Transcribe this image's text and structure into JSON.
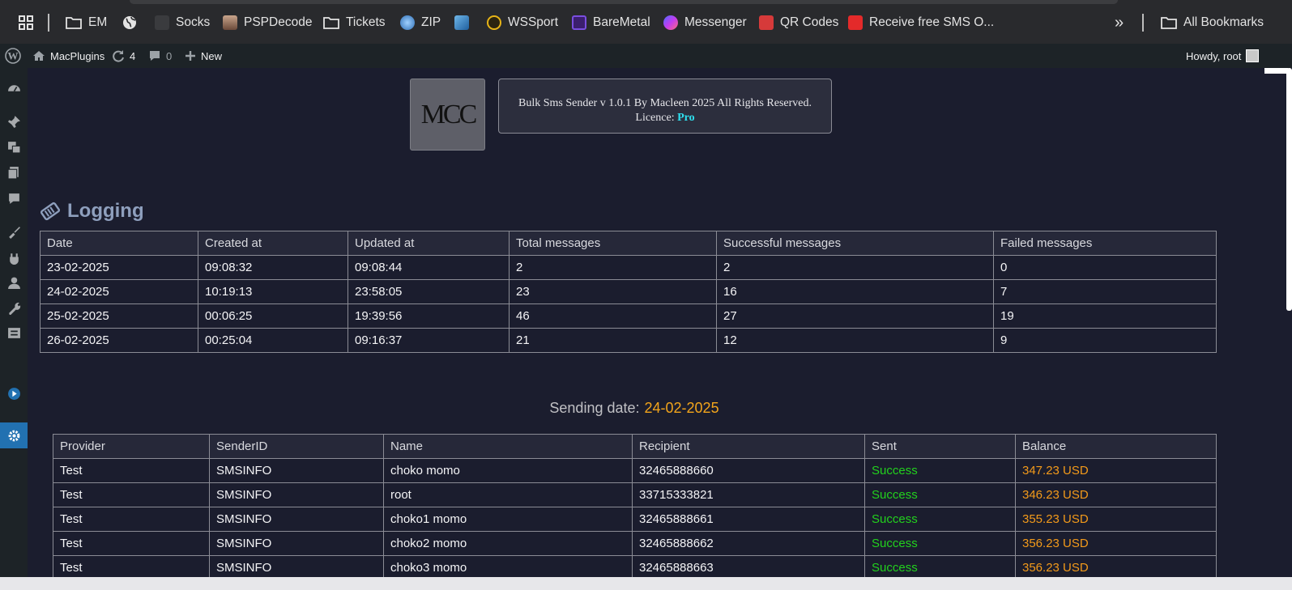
{
  "bookmarks": {
    "items": [
      {
        "label": "EM",
        "icon": "folder-icon"
      },
      {
        "label": "",
        "icon": "globe-icon"
      },
      {
        "label": "Socks",
        "icon": "socks-icon"
      },
      {
        "label": "PSPDecode",
        "icon": "avatar-icon"
      },
      {
        "label": "Tickets",
        "icon": "folder-icon"
      },
      {
        "label": "ZIP",
        "icon": "zip-icon"
      },
      {
        "label": "",
        "icon": "gear-badge-icon"
      },
      {
        "label": "WSSport",
        "icon": "wssport-icon"
      },
      {
        "label": "BareMetal",
        "icon": "baremetal-icon"
      },
      {
        "label": "Messenger",
        "icon": "messenger-icon"
      },
      {
        "label": "QR Codes",
        "icon": "qr-icon"
      },
      {
        "label": "Receive free SMS O...",
        "icon": "sms-icon"
      }
    ],
    "more_label": "»",
    "all_bookmarks": "All Bookmarks"
  },
  "adminbar": {
    "site": "MacPlugins",
    "updates": "4",
    "comments": "0",
    "new_label": "New",
    "howdy": "Howdy, root"
  },
  "plugin": {
    "logo_text": "MCC",
    "info_line1": "Bulk Sms Sender v 1.0.1 By Macleen 2025 All Rights Reserved.",
    "licence_label": "Licence:",
    "licence_value": "Pro"
  },
  "logging": {
    "title": "Logging",
    "headers": [
      "Date",
      "Created at",
      "Updated at",
      "Total messages",
      "Successful messages",
      "Failed messages"
    ],
    "rows": [
      [
        "23-02-2025",
        "09:08:32",
        "09:08:44",
        "2",
        "2",
        "0"
      ],
      [
        "24-02-2025",
        "10:19:13",
        "23:58:05",
        "23",
        "16",
        "7"
      ],
      [
        "25-02-2025",
        "00:06:25",
        "19:39:56",
        "46",
        "27",
        "19"
      ],
      [
        "26-02-2025",
        "00:25:04",
        "09:16:37",
        "21",
        "12",
        "9"
      ]
    ]
  },
  "sending": {
    "label": "Sending date:",
    "date": "24-02-2025",
    "headers": [
      "Provider",
      "SenderID",
      "Name",
      "Recipient",
      "Sent",
      "Balance"
    ],
    "rows": [
      [
        "Test",
        "SMSINFO",
        "choko momo",
        "32465888660",
        "Success",
        "347.23 USD"
      ],
      [
        "Test",
        "SMSINFO",
        "root",
        "33715333821",
        "Success",
        "346.23 USD"
      ],
      [
        "Test",
        "SMSINFO",
        "choko1 momo",
        "32465888661",
        "Success",
        "355.23 USD"
      ],
      [
        "Test",
        "SMSINFO",
        "choko2 momo",
        "32465888662",
        "Success",
        "356.23 USD"
      ],
      [
        "Test",
        "SMSINFO",
        "choko3 momo",
        "32465888663",
        "Success",
        "356.23 USD"
      ]
    ]
  },
  "colors": {
    "background": "#1b1d2e",
    "success": "#22d11d",
    "balance": "#f39a1a",
    "accent": "#2271b1",
    "licence": "#2ee0ef"
  }
}
